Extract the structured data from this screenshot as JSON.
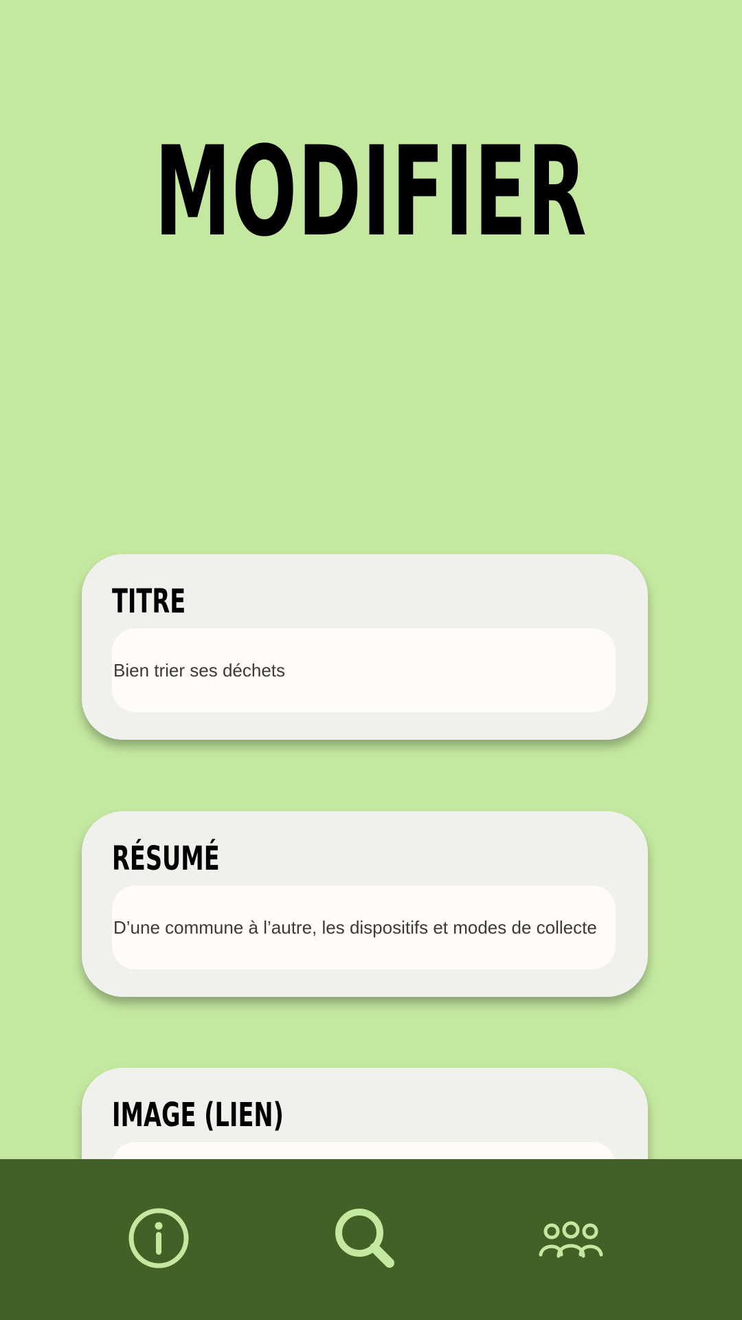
{
  "page": {
    "title": "MODIFIER"
  },
  "form": {
    "fields": [
      {
        "label": "TITRE",
        "value": "Bien trier ses déchets"
      },
      {
        "label": "RÉSUMÉ",
        "value": "D’une commune à l’autre, les dispositifs et modes de collecte"
      },
      {
        "label": "IMAGE (LIEN)",
        "value": ""
      }
    ]
  },
  "bottom_nav": {
    "items": [
      {
        "icon": "info-icon"
      },
      {
        "icon": "search-icon"
      },
      {
        "icon": "community-icon"
      }
    ]
  },
  "colors": {
    "background": "#c4e8a0",
    "card": "#f0f0ec",
    "field": "#fffcf8",
    "nav_bar": "#436127",
    "nav_icon": "#c4e8a0",
    "title": "#000000"
  }
}
